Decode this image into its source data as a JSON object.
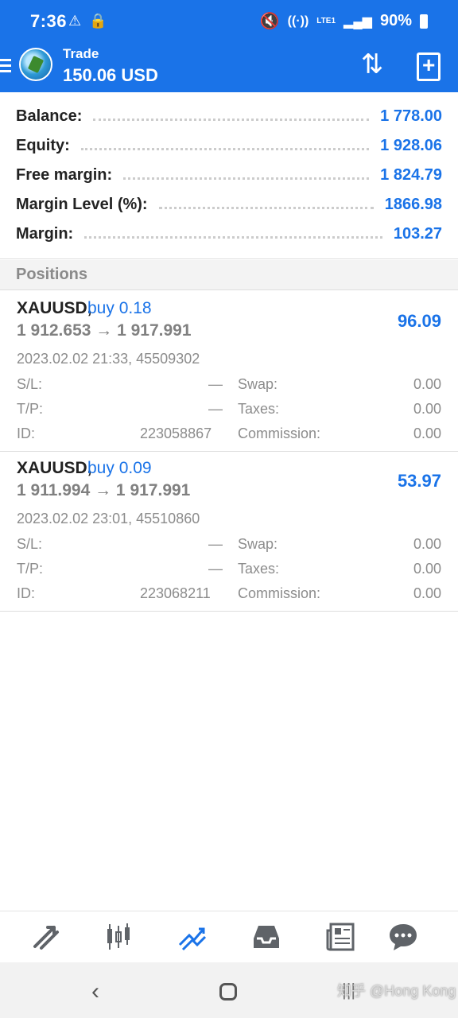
{
  "status_bar": {
    "time": "7:36",
    "battery": "90%",
    "network": "LTE1"
  },
  "toolbar": {
    "title": "Trade",
    "subtitle": "150.06 USD"
  },
  "summary": [
    {
      "label": "Balance:",
      "value": "1 778.00"
    },
    {
      "label": "Equity:",
      "value": "1 928.06"
    },
    {
      "label": "Free margin:",
      "value": "1 824.79"
    },
    {
      "label": "Margin Level (%):",
      "value": "1866.98"
    },
    {
      "label": "Margin:",
      "value": "103.27"
    }
  ],
  "positions_header": "Positions",
  "positions": [
    {
      "symbol": "XAUUSD,",
      "type": "buy 0.18",
      "price": "1 912.653 → 1 917.991",
      "profit": "96.09",
      "date": "2023.02.02 21:33, 45509302",
      "sl_label": "S/L:",
      "sl": "—",
      "tp_label": "T/P:",
      "tp": "—",
      "id_label": "ID:",
      "id": "223058867",
      "swap_label": "Swap:",
      "swap": "0.00",
      "taxes_label": "Taxes:",
      "taxes": "0.00",
      "commission_label": "Commission:",
      "commission": "0.00"
    },
    {
      "symbol": "XAUUSD,",
      "type": "buy 0.09",
      "price": "1 911.994 → 1 917.991",
      "profit": "53.97",
      "date": "2023.02.02 23:01, 45510860",
      "sl_label": "S/L:",
      "sl": "—",
      "tp_label": "T/P:",
      "tp": "—",
      "id_label": "ID:",
      "id": "223068211",
      "swap_label": "Swap:",
      "swap": "0.00",
      "taxes_label": "Taxes:",
      "taxes": "0.00",
      "commission_label": "Commission:",
      "commission": "0.00"
    }
  ],
  "bottom_nav": [
    "quotes-icon",
    "chart-icon",
    "trade-icon",
    "history-icon",
    "news-icon",
    "messages-icon"
  ],
  "accent_color": "#1a73e8",
  "watermark": "知乎 @Hong Kong"
}
